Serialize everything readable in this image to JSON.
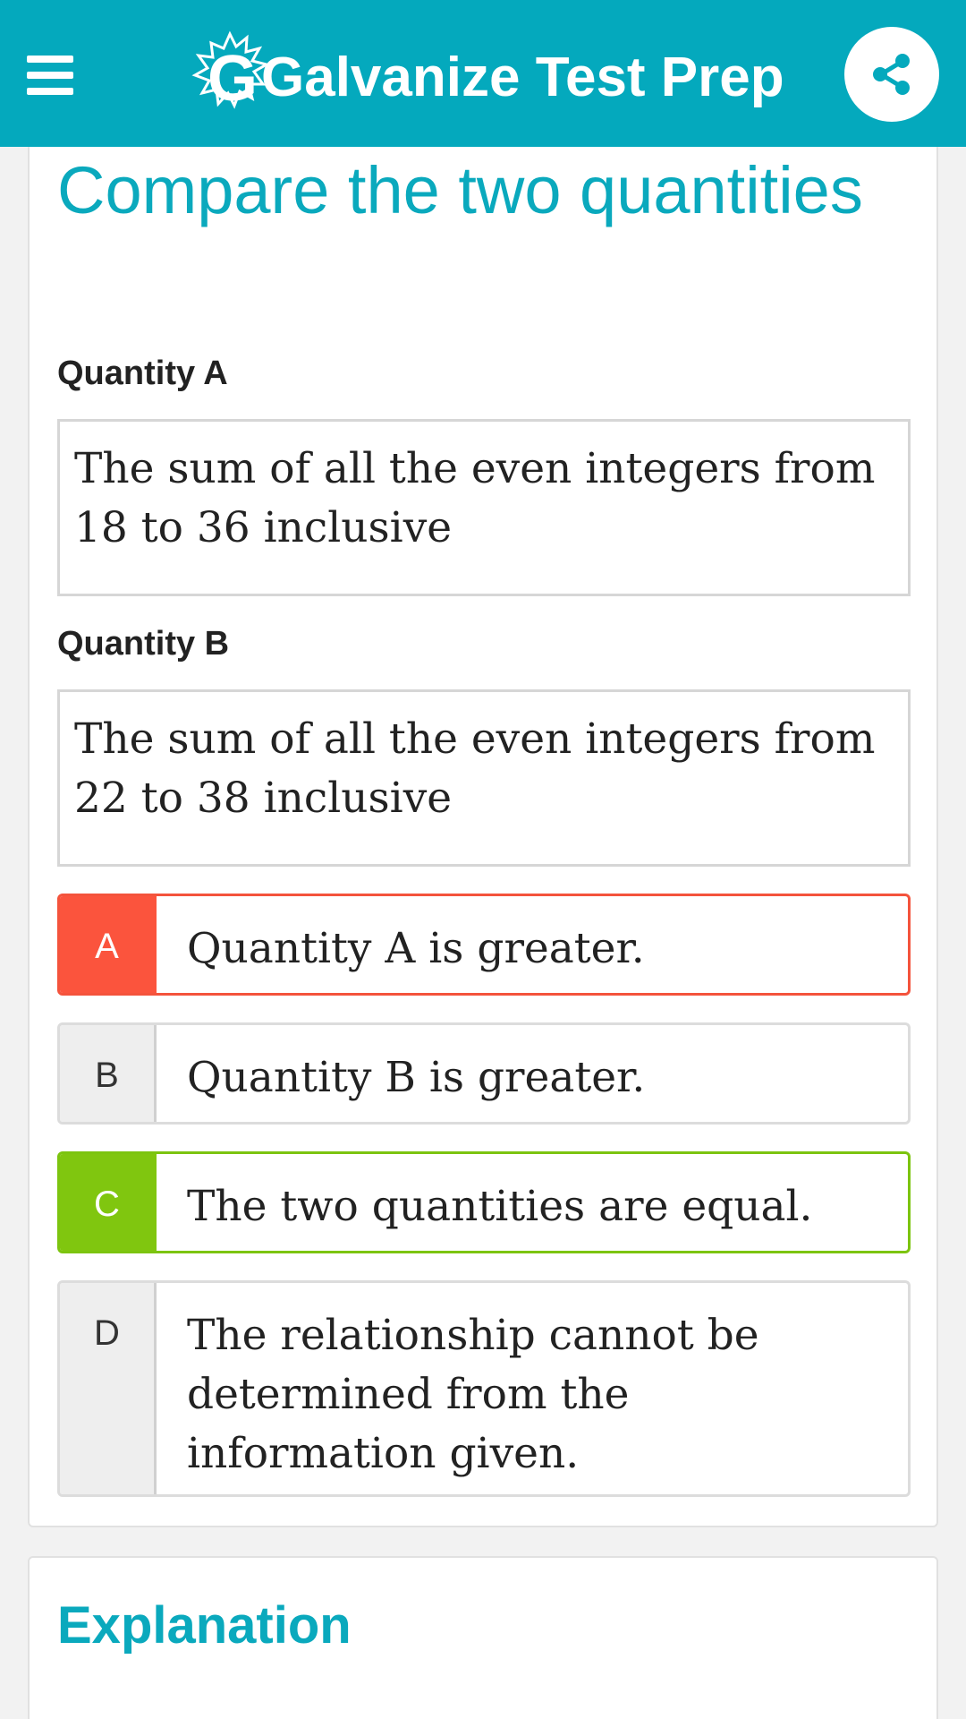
{
  "header": {
    "brand": "Galvanize Test Prep",
    "menu_icon": "hamburger-menu-icon",
    "share_icon": "share-icon",
    "background_color": "#04a9bd"
  },
  "question": {
    "title": "Compare the two quantities",
    "quantity_a": {
      "label": "Quantity A",
      "text": "The sum of all the even integers from 18 to 36 inclusive"
    },
    "quantity_b": {
      "label": "Quantity B",
      "text": "The sum of all the even integers from 22 to 38 inclusive"
    },
    "options": [
      {
        "letter": "A",
        "text": "Quantity A is greater.",
        "state": "incorrect",
        "color": "#fb543d"
      },
      {
        "letter": "B",
        "text": "Quantity B is greater.",
        "state": "neutral"
      },
      {
        "letter": "C",
        "text": "The two quantities are equal.",
        "state": "correct",
        "color": "#80c60f"
      },
      {
        "letter": "D",
        "text": "The relationship cannot be determined from the information given.",
        "state": "neutral"
      }
    ]
  },
  "explanation": {
    "title": "Explanation"
  },
  "colors": {
    "accent": "#0aa9bd"
  }
}
